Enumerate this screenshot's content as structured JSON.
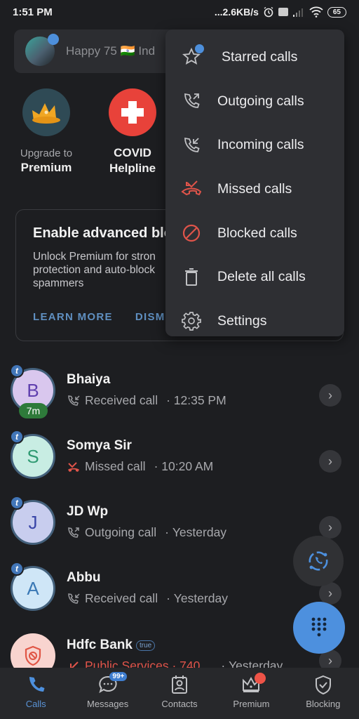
{
  "status_bar": {
    "time": "1:51 PM",
    "network_speed": "...2.6KB/s",
    "battery": "65",
    "icons": [
      "alarm-icon",
      "volte-icon",
      "signal-icon",
      "wifi-icon",
      "battery-icon"
    ]
  },
  "search": {
    "placeholder": "Happy 75 🇮🇳 Ind",
    "avatar_icon": "profile-avatar"
  },
  "quick_actions": [
    {
      "label_top": "Upgrade to",
      "label_bottom": "Premium",
      "icon": "crown-icon",
      "color": "#f0a623"
    },
    {
      "label_top": "COVID",
      "label_bottom": "Helpline",
      "icon": "medical-cross-icon",
      "color": "#e8423a"
    }
  ],
  "promo_card": {
    "title": "Enable advanced blo",
    "body": "Unlock Premium for stron protection and auto-block spammers",
    "learn_more": "LEARN MORE",
    "dismiss": "DISMI"
  },
  "calls": [
    {
      "name": "Bhaiya",
      "initial": "B",
      "type": "Received call",
      "type_icon": "incoming-call-icon",
      "time": "12:35 PM",
      "duration_badge": "7m",
      "avatar_bg": "#d9c7ee",
      "avatar_fg": "#5f3fae",
      "truecaller_badge": "t"
    },
    {
      "name": "Somya Sir",
      "initial": "S",
      "type": "Missed call",
      "type_icon": "missed-call-icon",
      "time": "10:20 AM",
      "avatar_bg": "#c8ede3",
      "avatar_fg": "#2f9a72",
      "truecaller_badge": "t"
    },
    {
      "name": "JD Wp",
      "initial": "J",
      "type": "Outgoing call",
      "type_icon": "outgoing-call-icon",
      "time": "Yesterday",
      "avatar_bg": "#c8cdee",
      "avatar_fg": "#3a46a8",
      "truecaller_badge": "t"
    },
    {
      "name": "Abbu",
      "initial": "A",
      "type": "Received call",
      "type_icon": "incoming-call-icon",
      "time": "Yesterday",
      "avatar_bg": "#cfe6f7",
      "avatar_fg": "#3a78b5",
      "truecaller_badge": "t"
    },
    {
      "name": "Hdfc Bank",
      "initial": "",
      "type": "Public Services · 740",
      "type_icon": "missed-call-icon",
      "time": "Yesterday",
      "verified_badge": "true",
      "avatar_bg": "#f8d4cf",
      "avatar_fg": "#e05545"
    }
  ],
  "menu": {
    "items": [
      {
        "label": "Starred calls",
        "icon": "star-icon"
      },
      {
        "label": "Outgoing calls",
        "icon": "outgoing-call-icon"
      },
      {
        "label": "Incoming calls",
        "icon": "incoming-call-icon"
      },
      {
        "label": "Missed calls",
        "icon": "missed-call-icon"
      },
      {
        "label": "Blocked calls",
        "icon": "block-icon"
      },
      {
        "label": "Delete all calls",
        "icon": "trash-icon"
      },
      {
        "label": "Settings",
        "icon": "gear-icon"
      }
    ]
  },
  "bottom_nav": {
    "items": [
      {
        "label": "Calls",
        "icon": "phone-icon",
        "active": true
      },
      {
        "label": "Messages",
        "icon": "chat-icon",
        "badge": "99+"
      },
      {
        "label": "Contacts",
        "icon": "contact-card-icon"
      },
      {
        "label": "Premium",
        "icon": "crown-icon",
        "dot": true
      },
      {
        "label": "Blocking",
        "icon": "shield-check-icon"
      }
    ]
  },
  "colors": {
    "accent": "#4d90de",
    "missed": "#e0544a",
    "background": "#1d1e21",
    "menu_bg": "#2e2f33"
  }
}
